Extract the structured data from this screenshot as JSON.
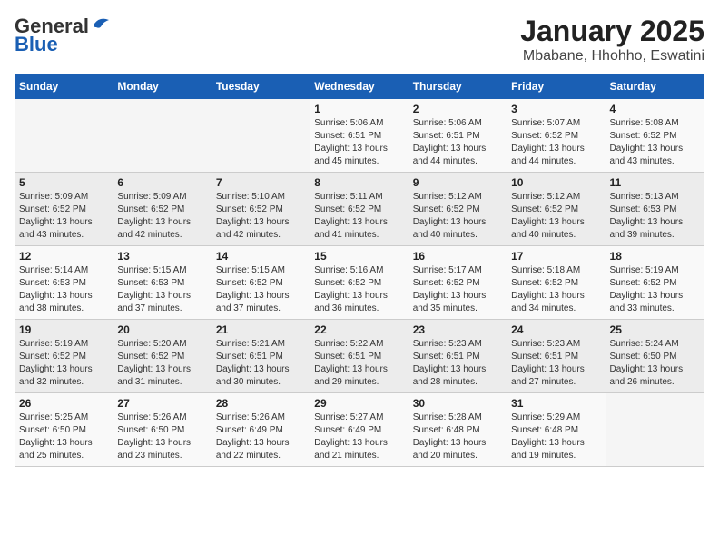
{
  "header": {
    "logo_general": "General",
    "logo_blue": "Blue",
    "title": "January 2025",
    "subtitle": "Mbabane, Hhohho, Eswatini"
  },
  "weekdays": [
    "Sunday",
    "Monday",
    "Tuesday",
    "Wednesday",
    "Thursday",
    "Friday",
    "Saturday"
  ],
  "weeks": [
    [
      {
        "day": "",
        "sunrise": "",
        "sunset": "",
        "daylight": ""
      },
      {
        "day": "",
        "sunrise": "",
        "sunset": "",
        "daylight": ""
      },
      {
        "day": "",
        "sunrise": "",
        "sunset": "",
        "daylight": ""
      },
      {
        "day": "1",
        "sunrise": "Sunrise: 5:06 AM",
        "sunset": "Sunset: 6:51 PM",
        "daylight": "Daylight: 13 hours and 45 minutes."
      },
      {
        "day": "2",
        "sunrise": "Sunrise: 5:06 AM",
        "sunset": "Sunset: 6:51 PM",
        "daylight": "Daylight: 13 hours and 44 minutes."
      },
      {
        "day": "3",
        "sunrise": "Sunrise: 5:07 AM",
        "sunset": "Sunset: 6:52 PM",
        "daylight": "Daylight: 13 hours and 44 minutes."
      },
      {
        "day": "4",
        "sunrise": "Sunrise: 5:08 AM",
        "sunset": "Sunset: 6:52 PM",
        "daylight": "Daylight: 13 hours and 43 minutes."
      }
    ],
    [
      {
        "day": "5",
        "sunrise": "Sunrise: 5:09 AM",
        "sunset": "Sunset: 6:52 PM",
        "daylight": "Daylight: 13 hours and 43 minutes."
      },
      {
        "day": "6",
        "sunrise": "Sunrise: 5:09 AM",
        "sunset": "Sunset: 6:52 PM",
        "daylight": "Daylight: 13 hours and 42 minutes."
      },
      {
        "day": "7",
        "sunrise": "Sunrise: 5:10 AM",
        "sunset": "Sunset: 6:52 PM",
        "daylight": "Daylight: 13 hours and 42 minutes."
      },
      {
        "day": "8",
        "sunrise": "Sunrise: 5:11 AM",
        "sunset": "Sunset: 6:52 PM",
        "daylight": "Daylight: 13 hours and 41 minutes."
      },
      {
        "day": "9",
        "sunrise": "Sunrise: 5:12 AM",
        "sunset": "Sunset: 6:52 PM",
        "daylight": "Daylight: 13 hours and 40 minutes."
      },
      {
        "day": "10",
        "sunrise": "Sunrise: 5:12 AM",
        "sunset": "Sunset: 6:52 PM",
        "daylight": "Daylight: 13 hours and 40 minutes."
      },
      {
        "day": "11",
        "sunrise": "Sunrise: 5:13 AM",
        "sunset": "Sunset: 6:53 PM",
        "daylight": "Daylight: 13 hours and 39 minutes."
      }
    ],
    [
      {
        "day": "12",
        "sunrise": "Sunrise: 5:14 AM",
        "sunset": "Sunset: 6:53 PM",
        "daylight": "Daylight: 13 hours and 38 minutes."
      },
      {
        "day": "13",
        "sunrise": "Sunrise: 5:15 AM",
        "sunset": "Sunset: 6:53 PM",
        "daylight": "Daylight: 13 hours and 37 minutes."
      },
      {
        "day": "14",
        "sunrise": "Sunrise: 5:15 AM",
        "sunset": "Sunset: 6:52 PM",
        "daylight": "Daylight: 13 hours and 37 minutes."
      },
      {
        "day": "15",
        "sunrise": "Sunrise: 5:16 AM",
        "sunset": "Sunset: 6:52 PM",
        "daylight": "Daylight: 13 hours and 36 minutes."
      },
      {
        "day": "16",
        "sunrise": "Sunrise: 5:17 AM",
        "sunset": "Sunset: 6:52 PM",
        "daylight": "Daylight: 13 hours and 35 minutes."
      },
      {
        "day": "17",
        "sunrise": "Sunrise: 5:18 AM",
        "sunset": "Sunset: 6:52 PM",
        "daylight": "Daylight: 13 hours and 34 minutes."
      },
      {
        "day": "18",
        "sunrise": "Sunrise: 5:19 AM",
        "sunset": "Sunset: 6:52 PM",
        "daylight": "Daylight: 13 hours and 33 minutes."
      }
    ],
    [
      {
        "day": "19",
        "sunrise": "Sunrise: 5:19 AM",
        "sunset": "Sunset: 6:52 PM",
        "daylight": "Daylight: 13 hours and 32 minutes."
      },
      {
        "day": "20",
        "sunrise": "Sunrise: 5:20 AM",
        "sunset": "Sunset: 6:52 PM",
        "daylight": "Daylight: 13 hours and 31 minutes."
      },
      {
        "day": "21",
        "sunrise": "Sunrise: 5:21 AM",
        "sunset": "Sunset: 6:51 PM",
        "daylight": "Daylight: 13 hours and 30 minutes."
      },
      {
        "day": "22",
        "sunrise": "Sunrise: 5:22 AM",
        "sunset": "Sunset: 6:51 PM",
        "daylight": "Daylight: 13 hours and 29 minutes."
      },
      {
        "day": "23",
        "sunrise": "Sunrise: 5:23 AM",
        "sunset": "Sunset: 6:51 PM",
        "daylight": "Daylight: 13 hours and 28 minutes."
      },
      {
        "day": "24",
        "sunrise": "Sunrise: 5:23 AM",
        "sunset": "Sunset: 6:51 PM",
        "daylight": "Daylight: 13 hours and 27 minutes."
      },
      {
        "day": "25",
        "sunrise": "Sunrise: 5:24 AM",
        "sunset": "Sunset: 6:50 PM",
        "daylight": "Daylight: 13 hours and 26 minutes."
      }
    ],
    [
      {
        "day": "26",
        "sunrise": "Sunrise: 5:25 AM",
        "sunset": "Sunset: 6:50 PM",
        "daylight": "Daylight: 13 hours and 25 minutes."
      },
      {
        "day": "27",
        "sunrise": "Sunrise: 5:26 AM",
        "sunset": "Sunset: 6:50 PM",
        "daylight": "Daylight: 13 hours and 23 minutes."
      },
      {
        "day": "28",
        "sunrise": "Sunrise: 5:26 AM",
        "sunset": "Sunset: 6:49 PM",
        "daylight": "Daylight: 13 hours and 22 minutes."
      },
      {
        "day": "29",
        "sunrise": "Sunrise: 5:27 AM",
        "sunset": "Sunset: 6:49 PM",
        "daylight": "Daylight: 13 hours and 21 minutes."
      },
      {
        "day": "30",
        "sunrise": "Sunrise: 5:28 AM",
        "sunset": "Sunset: 6:48 PM",
        "daylight": "Daylight: 13 hours and 20 minutes."
      },
      {
        "day": "31",
        "sunrise": "Sunrise: 5:29 AM",
        "sunset": "Sunset: 6:48 PM",
        "daylight": "Daylight: 13 hours and 19 minutes."
      },
      {
        "day": "",
        "sunrise": "",
        "sunset": "",
        "daylight": ""
      }
    ]
  ]
}
